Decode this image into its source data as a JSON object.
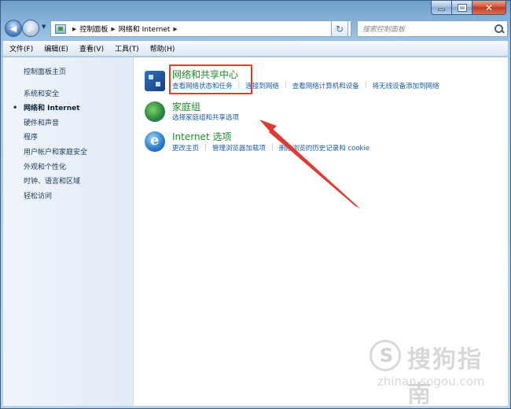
{
  "window": {
    "buttons": {
      "minimize": "",
      "maximize": "",
      "close": "✕"
    }
  },
  "nav": {
    "back_icon": "back-arrow-icon",
    "forward_icon": "forward-arrow-icon",
    "breadcrumb": [
      "控制面板",
      "网络和 Internet"
    ],
    "search_placeholder": "搜索控制面板",
    "refresh_glyph": "↻"
  },
  "menu": [
    "文件(F)",
    "编辑(E)",
    "查看(V)",
    "工具(T)",
    "帮助(H)"
  ],
  "sidebar": {
    "items": [
      {
        "label": "控制面板主页"
      },
      {
        "label": "系统和安全"
      },
      {
        "label": "网络和 Internet",
        "active": true
      },
      {
        "label": "硬件和声音"
      },
      {
        "label": "程序"
      },
      {
        "label": "用户帐户和家庭安全"
      },
      {
        "label": "外观和个性化"
      },
      {
        "label": "时钟、语言和区域"
      },
      {
        "label": "轻松访问"
      }
    ]
  },
  "categories": [
    {
      "title": "网络和共享中心",
      "icon": "network-center-icon",
      "links": [
        "查看网络状态和任务",
        "连接到网络",
        "查看网络计算机和设备",
        "将无线设备添加到网络"
      ]
    },
    {
      "title": "家庭组",
      "icon": "homegroup-icon",
      "links": [
        "选择家庭组和共享选项"
      ]
    },
    {
      "title": "Internet 选项",
      "icon": "internet-explorer-icon",
      "links": [
        "更改主页",
        "管理浏览器加载项",
        "删除浏览的历史记录和 cookie"
      ]
    }
  ],
  "annotation": {
    "highlight_color": "#e23a31",
    "arrow_color": "#e23a31"
  },
  "watermark": {
    "text": "搜狗指南",
    "url": "zhinan.sogou.com"
  },
  "colors": {
    "link": "#1a5bb5",
    "category_title": "#1d8c2d",
    "frame": "#a9cbe8"
  }
}
